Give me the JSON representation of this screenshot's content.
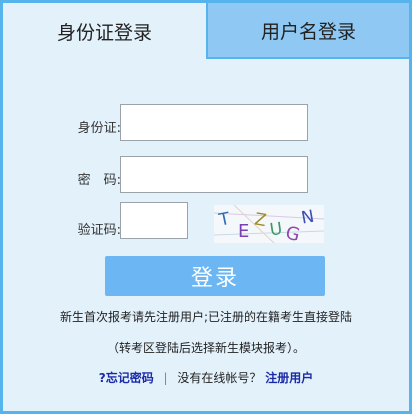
{
  "tabs": {
    "id_login": "身份证登录",
    "username_login": "用户名登录"
  },
  "form": {
    "id_label": "身份证:",
    "id_value": "",
    "password_label": "密　码:",
    "password_value": "",
    "captcha_label": "验证码:",
    "captcha_value": "",
    "captcha_text": "TEZUGN"
  },
  "login_button": "登录",
  "notes": {
    "line1": "新生首次报考请先注册用户;已注册的在籍考生直接登陆",
    "line2": "（转考区登陆后选择新生模块报考）。"
  },
  "links": {
    "forgot_password": "?忘记密码",
    "separator": "|",
    "no_account": "没有在线帐号？",
    "register": "注册用户"
  },
  "colors": {
    "border": "#56b3ec",
    "panel_bg": "#e3f1fb",
    "active_tab_bg": "#8ec8f3",
    "button_bg": "#6cb6f3",
    "link": "#1b2ba8"
  }
}
